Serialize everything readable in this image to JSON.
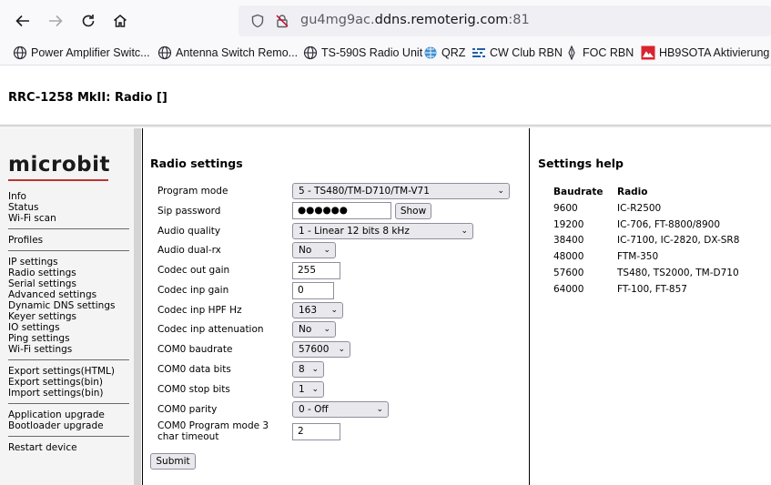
{
  "browser": {
    "url_prefix": "gu4mg9ac.",
    "url_domain": "ddns.remoterig.com",
    "url_port": ":81",
    "bookmarks": [
      {
        "label": "Power Amplifier Switc...",
        "icon": "globe-icon"
      },
      {
        "label": "Antenna Switch Remo...",
        "icon": "globe-icon"
      },
      {
        "label": "TS-590S Radio Unit",
        "icon": "globe-icon"
      },
      {
        "label": "QRZ",
        "icon": "qrz-icon"
      },
      {
        "label": "CW Club RBN",
        "icon": "rbn-icon"
      },
      {
        "label": "FOC RBN",
        "icon": "foc-icon"
      },
      {
        "label": "HB9SOTA Aktivierung",
        "icon": "sota-icon"
      }
    ]
  },
  "page": {
    "title": "RRC-1258 MkII: Radio []"
  },
  "sidebar": {
    "logo": "microbit",
    "groups": [
      [
        "Info",
        "Status",
        "Wi-Fi scan"
      ],
      [
        "Profiles"
      ],
      [
        "IP settings",
        "Radio settings",
        "Serial settings",
        "Advanced settings",
        "Dynamic DNS settings",
        "Keyer settings",
        "IO settings",
        "Ping settings",
        "Wi-Fi settings"
      ],
      [
        "Export settings(HTML)",
        "Export settings(bin)",
        "Import settings(bin)"
      ],
      [
        "Application upgrade",
        "Bootloader upgrade"
      ],
      [
        "Restart device"
      ]
    ]
  },
  "form": {
    "title": "Radio settings",
    "fields": {
      "program_mode": {
        "label": "Program mode",
        "value": "5 - TS480/TM-D710/TM-V71"
      },
      "sip_password": {
        "label": "Sip password",
        "value": "●●●●●●",
        "button": "Show"
      },
      "audio_quality": {
        "label": "Audio quality",
        "value": "1 - Linear 12 bits 8 kHz"
      },
      "audio_dual_rx": {
        "label": "Audio dual-rx",
        "value": "No"
      },
      "codec_out_gain": {
        "label": "Codec out gain",
        "value": "255"
      },
      "codec_inp_gain": {
        "label": "Codec inp gain",
        "value": "0"
      },
      "codec_inp_hpf": {
        "label": "Codec inp HPF Hz",
        "value": "163"
      },
      "codec_inp_atten": {
        "label": "Codec inp attenuation",
        "value": "No"
      },
      "com0_baudrate": {
        "label": "COM0 baudrate",
        "value": "57600"
      },
      "com0_data_bits": {
        "label": "COM0 data bits",
        "value": "8"
      },
      "com0_stop_bits": {
        "label": "COM0 stop bits",
        "value": "1"
      },
      "com0_parity": {
        "label": "COM0 parity",
        "value": "0 - Off"
      },
      "com0_pm3_timeout": {
        "label_line1": "COM0 Program mode 3",
        "label_line2": "char timeout",
        "value": "2"
      }
    },
    "submit": "Submit"
  },
  "help": {
    "title": "Settings help",
    "headers": [
      "Baudrate",
      "Radio"
    ],
    "rows": [
      [
        "9600",
        "IC-R2500"
      ],
      [
        "19200",
        "IC-706, FT-8800/8900"
      ],
      [
        "38400",
        "IC-7100, IC-2820, DX-SR8"
      ],
      [
        "48000",
        "FTM-350"
      ],
      [
        "57600",
        "TS480, TS2000, TM-D710"
      ],
      [
        "64000",
        "FT-100, FT-857"
      ]
    ]
  }
}
